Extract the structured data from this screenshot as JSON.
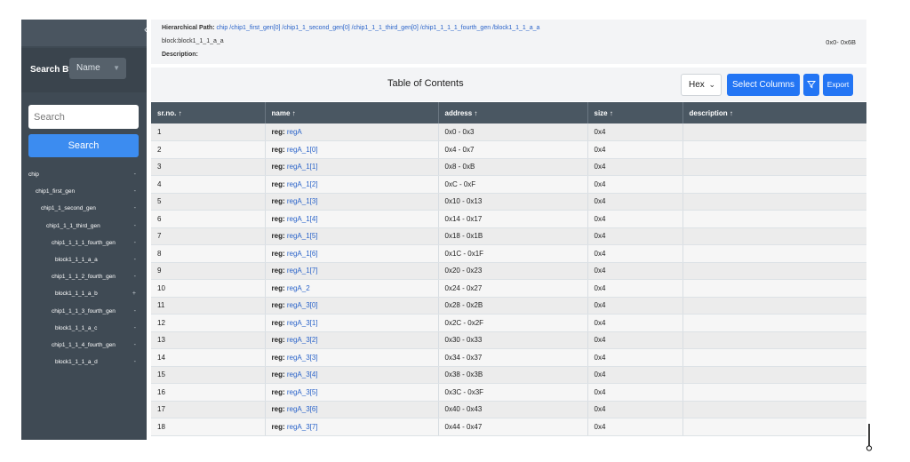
{
  "sidebar": {
    "collapse_glyph": "‹",
    "search_by_label": "Search By:",
    "search_by_value": "Name",
    "search_placeholder": "Search",
    "search_button": "Search",
    "tree": [
      {
        "label": "chip",
        "marker": "-"
      },
      {
        "label": "chip1_first_gen",
        "marker": "-"
      },
      {
        "label": "chip1_1_second_gen",
        "marker": "-"
      },
      {
        "label": "chip1_1_1_third_gen",
        "marker": "-"
      },
      {
        "label": "chip1_1_1_1_fourth_gen",
        "marker": "-"
      },
      {
        "label": "block1_1_1_a_a",
        "marker": "-"
      },
      {
        "label": "chip1_1_1_2_fourth_gen",
        "marker": "-"
      },
      {
        "label": "block1_1_1_a_b",
        "marker": "+"
      },
      {
        "label": "chip1_1_1_3_fourth_gen",
        "marker": "-"
      },
      {
        "label": "block1_1_1_a_c",
        "marker": "-"
      },
      {
        "label": "chip1_1_1_4_fourth_gen",
        "marker": "-"
      },
      {
        "label": "block1_1_1_a_d",
        "marker": "-"
      }
    ]
  },
  "header": {
    "path_label": "Hierarchical Path:",
    "path": "chip /chip1_first_gen[0] /chip1_1_second_gen[0] /chip1_1_1_third_gen[0] /chip1_1_1_1_fourth_gen /block1_1_1_a_a",
    "block": "block:block1_1_1_a_a",
    "range": "0x0- 0x6B",
    "description_label": "Description:"
  },
  "toolbar": {
    "title": "Table of Contents",
    "format_value": "Hex",
    "select_columns": "Select Columns",
    "filter_icon": "filter-icon",
    "export": "Export"
  },
  "table": {
    "columns": [
      "sr.no. ↑",
      "name ↑",
      "address ↑",
      "size ↑",
      "description ↑"
    ],
    "rows": [
      {
        "sr": "1",
        "kw": "reg:",
        "name": "regA",
        "address": "0x0 - 0x3",
        "size": "0x4",
        "description": ""
      },
      {
        "sr": "2",
        "kw": "reg:",
        "name": "regA_1[0]",
        "address": "0x4 - 0x7",
        "size": "0x4",
        "description": ""
      },
      {
        "sr": "3",
        "kw": "reg:",
        "name": "regA_1[1]",
        "address": "0x8 - 0xB",
        "size": "0x4",
        "description": ""
      },
      {
        "sr": "4",
        "kw": "reg:",
        "name": "regA_1[2]",
        "address": "0xC - 0xF",
        "size": "0x4",
        "description": ""
      },
      {
        "sr": "5",
        "kw": "reg:",
        "name": "regA_1[3]",
        "address": "0x10 - 0x13",
        "size": "0x4",
        "description": ""
      },
      {
        "sr": "6",
        "kw": "reg:",
        "name": "regA_1[4]",
        "address": "0x14 - 0x17",
        "size": "0x4",
        "description": ""
      },
      {
        "sr": "7",
        "kw": "reg:",
        "name": "regA_1[5]",
        "address": "0x18 - 0x1B",
        "size": "0x4",
        "description": ""
      },
      {
        "sr": "8",
        "kw": "reg:",
        "name": "regA_1[6]",
        "address": "0x1C - 0x1F",
        "size": "0x4",
        "description": ""
      },
      {
        "sr": "9",
        "kw": "reg:",
        "name": "regA_1[7]",
        "address": "0x20 - 0x23",
        "size": "0x4",
        "description": ""
      },
      {
        "sr": "10",
        "kw": "reg:",
        "name": "regA_2",
        "address": "0x24 - 0x27",
        "size": "0x4",
        "description": ""
      },
      {
        "sr": "11",
        "kw": "reg:",
        "name": "regA_3[0]",
        "address": "0x28 - 0x2B",
        "size": "0x4",
        "description": ""
      },
      {
        "sr": "12",
        "kw": "reg:",
        "name": "regA_3[1]",
        "address": "0x2C - 0x2F",
        "size": "0x4",
        "description": ""
      },
      {
        "sr": "13",
        "kw": "reg:",
        "name": "regA_3[2]",
        "address": "0x30 - 0x33",
        "size": "0x4",
        "description": ""
      },
      {
        "sr": "14",
        "kw": "reg:",
        "name": "regA_3[3]",
        "address": "0x34 - 0x37",
        "size": "0x4",
        "description": ""
      },
      {
        "sr": "15",
        "kw": "reg:",
        "name": "regA_3[4]",
        "address": "0x38 - 0x3B",
        "size": "0x4",
        "description": ""
      },
      {
        "sr": "16",
        "kw": "reg:",
        "name": "regA_3[5]",
        "address": "0x3C - 0x3F",
        "size": "0x4",
        "description": ""
      },
      {
        "sr": "17",
        "kw": "reg:",
        "name": "regA_3[6]",
        "address": "0x40 - 0x43",
        "size": "0x4",
        "description": ""
      },
      {
        "sr": "18",
        "kw": "reg:",
        "name": "regA_3[7]",
        "address": "0x44 - 0x47",
        "size": "0x4",
        "description": ""
      }
    ]
  },
  "cursor_icon": "text-cursor-icon"
}
